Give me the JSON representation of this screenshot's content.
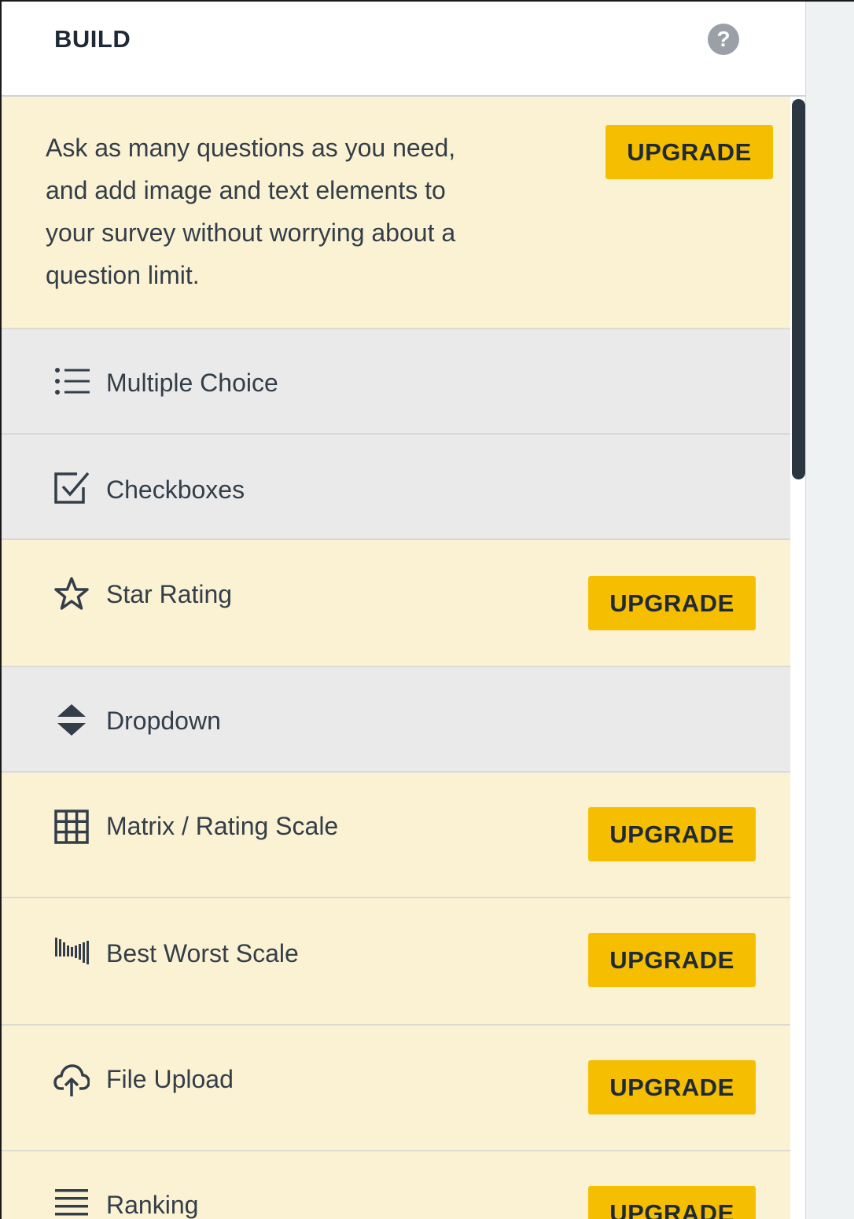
{
  "header": {
    "title": "BUILD",
    "help_glyph": "?",
    "help_icon": "help-circle-icon"
  },
  "promo": {
    "text": "Ask as many questions as you need, and add image and text elements to your survey without worrying about a question limit.",
    "button": "UPGRADE"
  },
  "question_types": [
    {
      "label": "Multiple Choice",
      "icon": "list-icon",
      "upgrade": ""
    },
    {
      "label": "Checkboxes",
      "icon": "checkbox-icon",
      "upgrade": ""
    },
    {
      "label": "Star Rating",
      "icon": "star-icon",
      "upgrade": "UPGRADE"
    },
    {
      "label": "Dropdown",
      "icon": "dropdown-arrows-icon",
      "upgrade": ""
    },
    {
      "label": "Matrix / Rating Scale",
      "icon": "grid-icon",
      "upgrade": "UPGRADE"
    },
    {
      "label": "Best Worst Scale",
      "icon": "scale-bars-icon",
      "upgrade": "UPGRADE"
    },
    {
      "label": "File Upload",
      "icon": "cloud-upload-icon",
      "upgrade": "UPGRADE"
    },
    {
      "label": "Ranking",
      "icon": "ranking-lines-icon",
      "upgrade": "UPGRADE"
    }
  ],
  "colors": {
    "upgrade_button": "#f5be00",
    "paid_row_bg": "#fbf2d4",
    "free_row_bg": "#eaeaeb",
    "text": "#333e48"
  }
}
